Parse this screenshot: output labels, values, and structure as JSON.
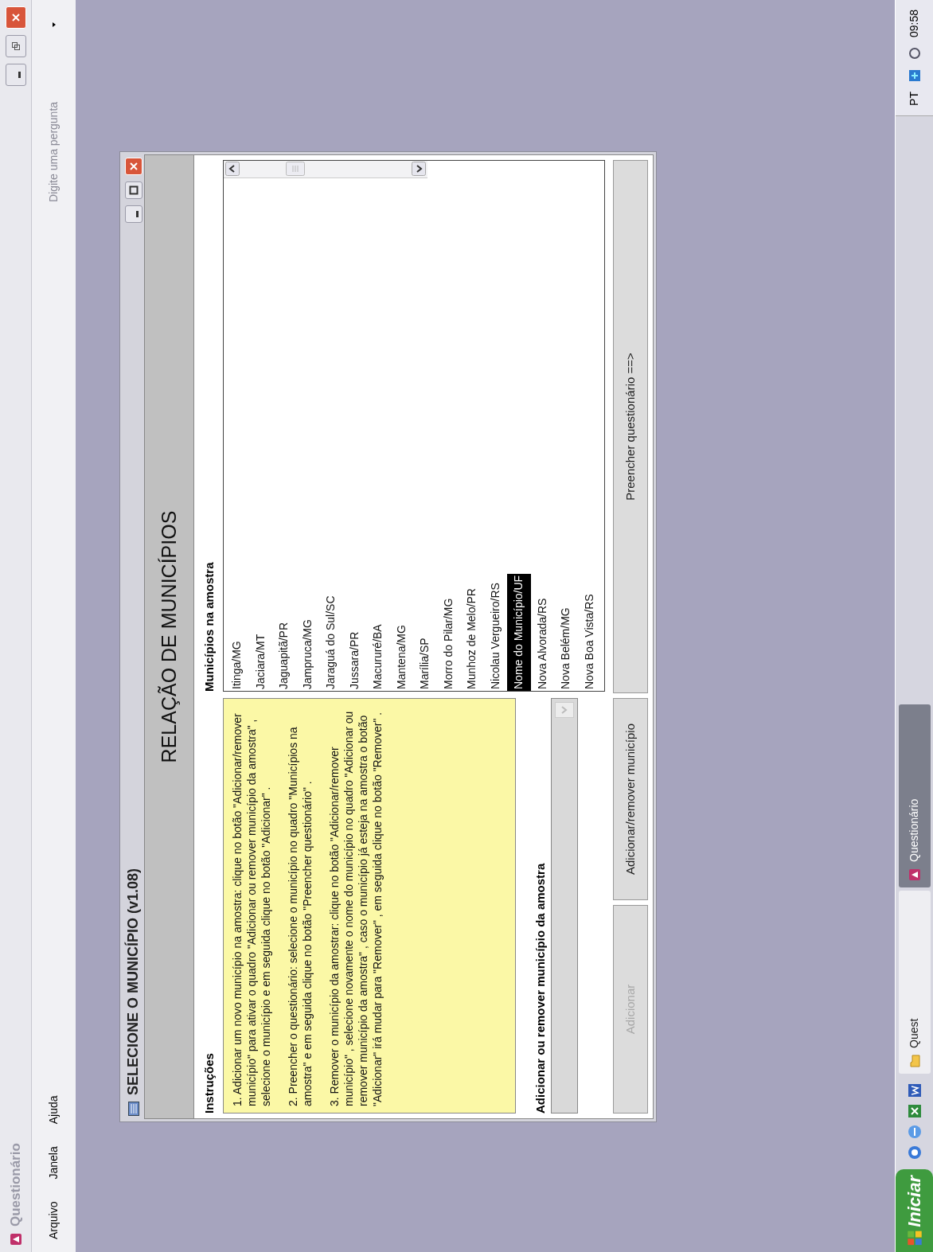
{
  "app_window": {
    "title": "Questionário",
    "menu": [
      "Arquivo",
      "Janela",
      "Ajuda"
    ],
    "help_box": {
      "placeholder": "Digite uma pergunta"
    }
  },
  "dialog": {
    "title": "SELECIONE O MUNICÍPIO (v1.08)",
    "header": "RELAÇÃO DE MUNICÍPIOS",
    "instructions": {
      "label": "Instruções",
      "paragraphs": [
        "1. Adicionar um novo município na amostra: clique no botão \"Adicionar/remover município\" para ativar o quadro \"Adicionar ou remover município da amostra\" , selecione o município e em seguida clique no botão \"Adicionar\" .",
        "2. Preencher o questionário: selecione o município no quadro \"Municípios na amostra\" e em seguida clique no botão \"Preencher questionário\" .",
        "3. Remover o município da amostrar: clique no botão \"Adicionar/remover município\" , selecione novamente o nome do município no quadro \"Adicionar ou remover município da amostra\" , caso o município já esteja na amostra o botão \"Adicionar\" irá mudar para \"Remover\" , em seguida clique no botão \"Remover\" ."
      ]
    },
    "add_remove": {
      "label": "Adicionar ou remover município da amostra",
      "combo_disabled": true
    },
    "sample": {
      "label": "Municípios na amostra",
      "items": [
        {
          "label": "Itinga/MG",
          "selected": false
        },
        {
          "label": "Jaciara/MT",
          "selected": false
        },
        {
          "label": "Jaguapitã/PR",
          "selected": false
        },
        {
          "label": "Jamprucа/MG",
          "selected": false
        },
        {
          "label": "Jaraguá do Sul/SC",
          "selected": false
        },
        {
          "label": "Jussara/PR",
          "selected": false
        },
        {
          "label": "Macururé/BA",
          "selected": false
        },
        {
          "label": "Mantena/MG",
          "selected": false
        },
        {
          "label": "Marília/SP",
          "selected": false
        },
        {
          "label": "Morro do Pilar/MG",
          "selected": false
        },
        {
          "label": "Munhoz de Melo/PR",
          "selected": false
        },
        {
          "label": "Nicolau Vergueiro/RS",
          "selected": false
        },
        {
          "label": "Nome do Município/UF",
          "selected": true
        },
        {
          "label": "Nova Alvorada/RS",
          "selected": false
        },
        {
          "label": "Nova Belém/MG",
          "selected": false
        },
        {
          "label": "Nova Boa Vista/RS",
          "selected": false
        }
      ]
    },
    "buttons": [
      {
        "label": "Adicionar",
        "disabled": true
      },
      {
        "label": "Adicionar/remover município",
        "disabled": false
      },
      {
        "label": "Preencher questionário ==>",
        "disabled": false
      }
    ]
  },
  "taskbar": {
    "start": "Iniciar",
    "tasks": [
      {
        "label": "Quest",
        "kind": "folder",
        "selected": false
      },
      {
        "label": "Questionário",
        "kind": "app",
        "selected": true
      }
    ],
    "language": "PT",
    "clock": "09:58"
  }
}
